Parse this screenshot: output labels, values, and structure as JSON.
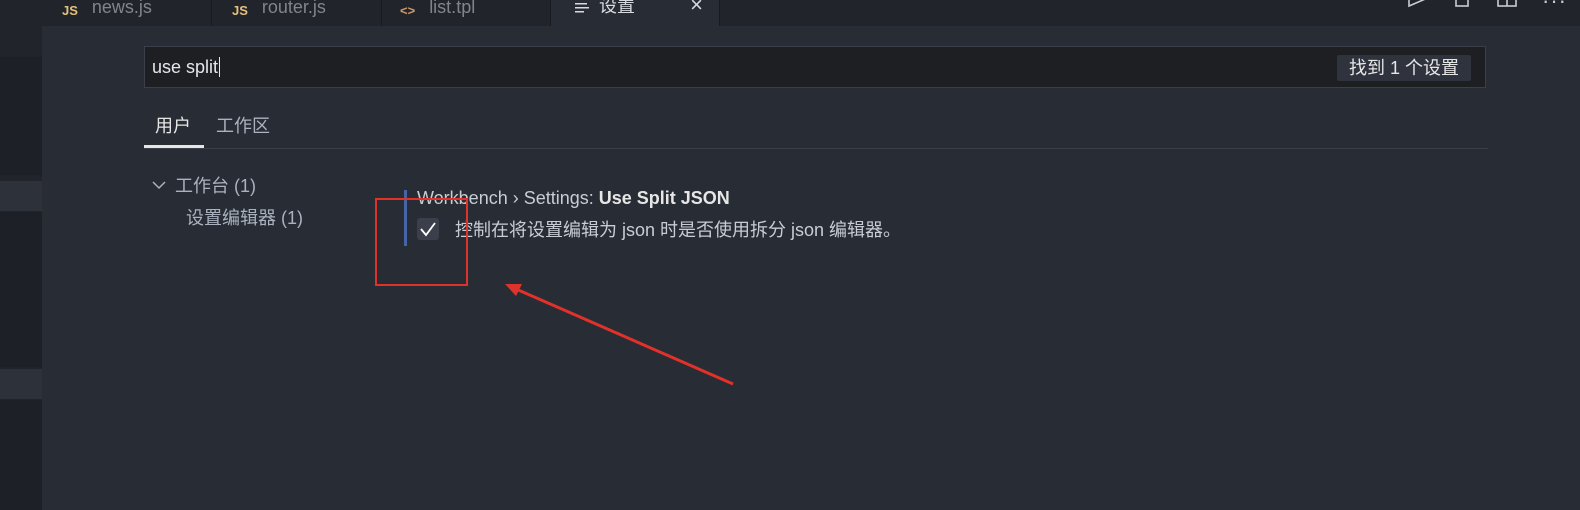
{
  "tabs": [
    {
      "label": "news.js",
      "icon": "JS",
      "icon_color": "#e5c07b"
    },
    {
      "label": "router.js",
      "icon": "JS",
      "icon_color": "#e5c07b"
    },
    {
      "label": "list.tpl",
      "icon": "<>",
      "icon_color": "#d19a66"
    },
    {
      "label": "设置",
      "icon": "settings-lines-icon",
      "active": true
    }
  ],
  "search": {
    "value": "use split",
    "result_count": "找到 1 个设置"
  },
  "scope_tabs": {
    "user": "用户",
    "workspace": "工作区"
  },
  "toc": {
    "root_label": "工作台 (1)",
    "child_label": "设置编辑器 (1)"
  },
  "setting": {
    "category": "Workbench › Settings: ",
    "name": "Use Split JSON",
    "description": "控制在将设置编辑为 json 时是否使用拆分 json 编辑器。",
    "checked": true
  },
  "colors": {
    "accent": "#4d78cc",
    "annotation": "#e0322a",
    "background": "#282c34"
  }
}
